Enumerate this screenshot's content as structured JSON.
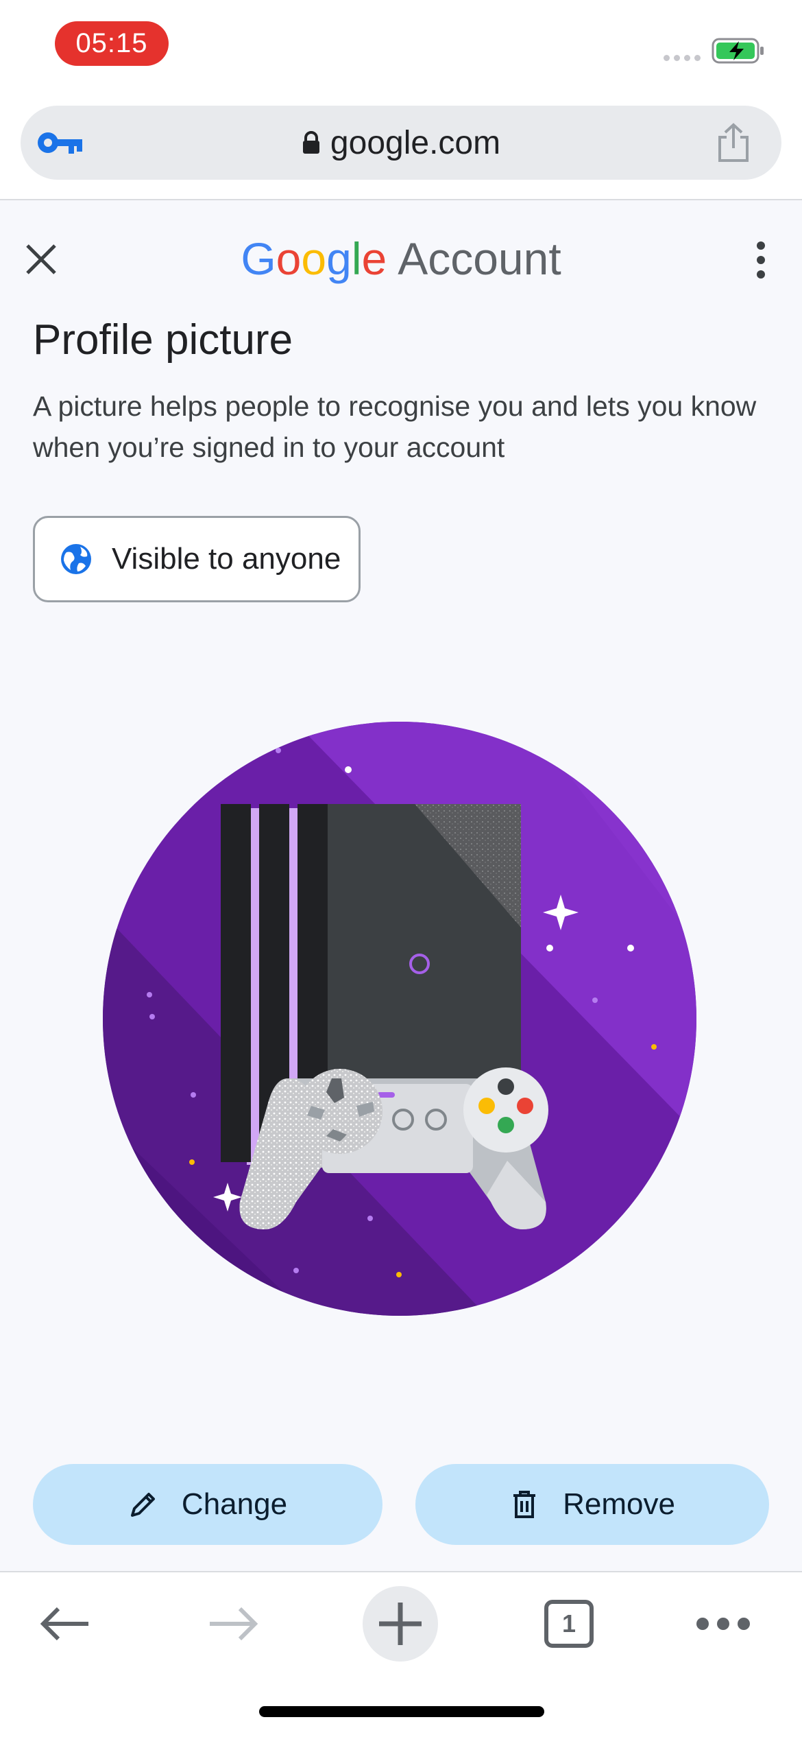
{
  "status_bar": {
    "time": "05:15",
    "battery_state": "charging",
    "icons": [
      "signal-dots-icon",
      "battery-charging-icon"
    ]
  },
  "browser": {
    "url": "google.com",
    "icons": [
      "key-icon",
      "lock-icon",
      "share-icon"
    ]
  },
  "header": {
    "brand_g": "G",
    "brand_o1": "o",
    "brand_o2": "o",
    "brand_g2": "g",
    "brand_l": "l",
    "brand_e": "e",
    "brand_suffix": "Account",
    "icons": [
      "close-icon",
      "more-vert-icon"
    ]
  },
  "profile": {
    "title": "Profile picture",
    "description": "A picture helps people to recognise you and lets you know when you’re signed in to your account",
    "visibility_label": "Visible to anyone",
    "avatar_icon": "game-console-avatar"
  },
  "actions": {
    "change_label": "Change",
    "remove_label": "Remove",
    "icons": [
      "pencil-icon",
      "trash-icon"
    ]
  },
  "toolbar": {
    "tab_count": "1",
    "icons": [
      "back-arrow-icon",
      "forward-arrow-icon",
      "plus-icon",
      "tabs-icon",
      "more-horiz-icon"
    ]
  },
  "colors": {
    "accent": "#1a73e8",
    "button_bg": "#c2e4fb",
    "time_pill": "#e5322d",
    "avatar_purple": "#7b2cbf"
  }
}
